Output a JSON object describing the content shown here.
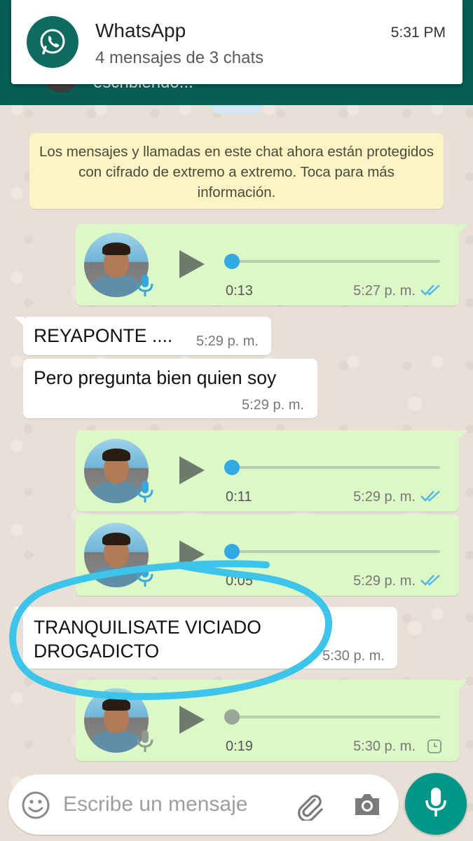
{
  "notification": {
    "app_name": "WhatsApp",
    "summary": "4 mensajes de 3 chats",
    "time": "5:31 PM"
  },
  "header": {
    "subtitle_peek": "escribiendo..."
  },
  "encryption_notice": "Los mensajes y llamadas en este chat ahora están protegidos con cifrado de extremo a extremo. Toca para más información.",
  "messages": [
    {
      "type": "voice",
      "direction": "outgoing",
      "duration": "0:13",
      "time": "5:27 p. m.",
      "status": "read"
    },
    {
      "type": "text",
      "direction": "incoming",
      "text": "REYAPONTE ....",
      "time": "5:29 p. m."
    },
    {
      "type": "text",
      "direction": "incoming",
      "text": "Pero pregunta bien quien soy",
      "time": "5:29 p. m."
    },
    {
      "type": "voice",
      "direction": "outgoing",
      "duration": "0:11",
      "time": "5:29 p. m.",
      "status": "read"
    },
    {
      "type": "voice",
      "direction": "outgoing",
      "duration": "0:05",
      "time": "5:29 p. m.",
      "status": "read"
    },
    {
      "type": "text",
      "direction": "incoming",
      "text_line1": "TRANQUILISATE VICIADO",
      "text_line2": "DROGADICTO",
      "time": "5:30 p. m."
    },
    {
      "type": "voice",
      "direction": "outgoing",
      "duration": "0:19",
      "time": "5:30 p. m.",
      "status": "pending"
    }
  ],
  "composer": {
    "placeholder": "Escribe un mensaje"
  },
  "colors": {
    "header": "#075e54",
    "outgoing_bubble": "#dcf8c6",
    "incoming_bubble": "#ffffff",
    "read_ticks": "#4fb6ec",
    "mic_button": "#009688",
    "highlight_stroke": "#3cc4ea"
  }
}
